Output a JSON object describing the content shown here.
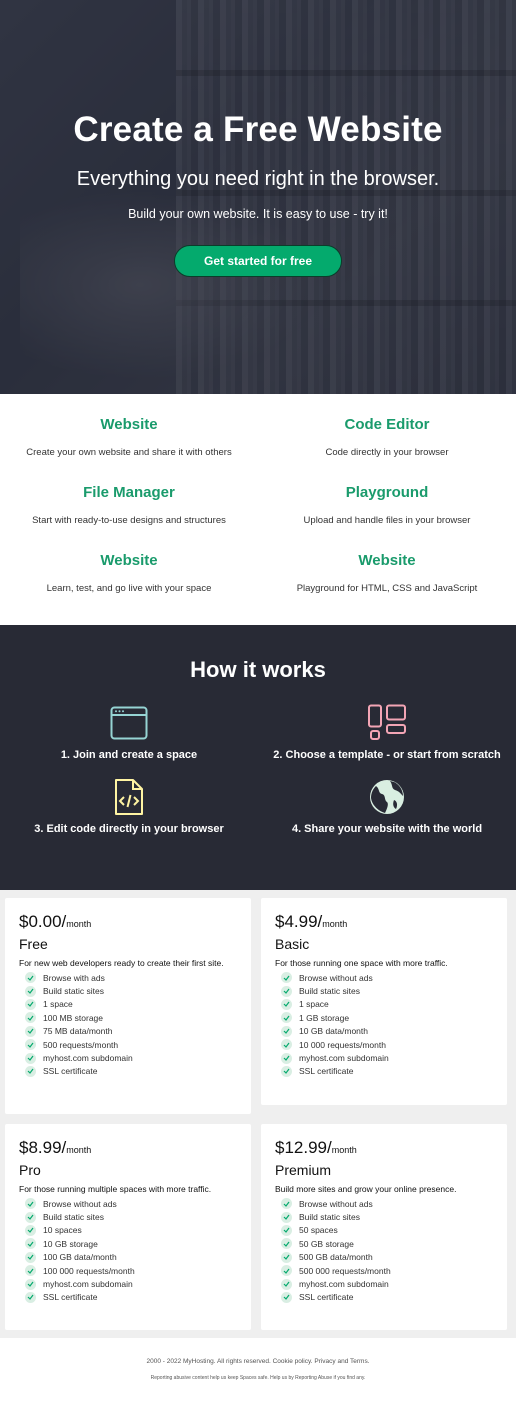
{
  "hero": {
    "title": "Create a Free Website",
    "subtitle": "Everything you need right in the browser.",
    "tagline": "Build your own website. It is easy to use - try it!",
    "cta": "Get started for free"
  },
  "features": [
    {
      "title": "Website",
      "text": "Create your own website and share it with others"
    },
    {
      "title": "Code Editor",
      "text": "Code directly in your browser"
    },
    {
      "title": "File Manager",
      "text": "Start with ready-to-use designs and structures"
    },
    {
      "title": "Playground",
      "text": "Upload and handle files in your browser"
    },
    {
      "title": "Website",
      "text": "Learn, test, and go live with your space"
    },
    {
      "title": "Website",
      "text": "Playground for HTML, CSS and JavaScript"
    }
  ],
  "how": {
    "title": "How it works",
    "steps": [
      {
        "label": "1. Join and create a space",
        "icon": "browser-window-icon"
      },
      {
        "label": "2. Choose a template - or start from scratch",
        "icon": "layout-template-icon"
      },
      {
        "label": "3. Edit code directly in your browser",
        "icon": "code-file-icon"
      },
      {
        "label": "4. Share your website with the world",
        "icon": "globe-icon"
      }
    ]
  },
  "plans": [
    {
      "price": "$0.00/",
      "per": "month",
      "name": "Free",
      "desc": "For new web developers ready to create their first site.",
      "features": [
        "Browse with ads",
        "Build static sites",
        "1 space",
        "100 MB storage",
        "75 MB data/month",
        "500 requests/month",
        "myhost.com subdomain",
        "SSL certificate"
      ]
    },
    {
      "price": "$4.99/",
      "per": "month",
      "name": "Basic",
      "desc": "For those running one space with more traffic.",
      "features": [
        "Browse without ads",
        "Build static sites",
        "1 space",
        "1 GB storage",
        "10 GB data/month",
        "10 000 requests/month",
        "myhost.com subdomain",
        "SSL certificate"
      ]
    },
    {
      "price": "$8.99/",
      "per": "month",
      "name": "Pro",
      "desc": "For those running multiple spaces with more traffic.",
      "features": [
        "Browse without ads",
        "Build static sites",
        "10 spaces",
        "10 GB storage",
        "100 GB data/month",
        "100 000 requests/month",
        "myhost.com subdomain",
        "SSL certificate"
      ]
    },
    {
      "price": "$12.99/",
      "per": "month",
      "name": "Premium",
      "desc": "Build more sites and grow your online presence.",
      "features": [
        "Browse without ads",
        "Build static sites",
        "50 spaces",
        "50 GB storage",
        "500 GB data/month",
        "500 000 requests/month",
        "myhost.com subdomain",
        "SSL certificate"
      ]
    }
  ],
  "footer": {
    "line1": "2000 - 2022 MyHosting. All rights reserved. Cookie policy. Privacy and Terms.",
    "line2": "Reporting abusive content help us keep Spaces safe. Help us by Reporting Abuse if you find any."
  },
  "colors": {
    "accent": "#04aa6d",
    "dark": "#282a35",
    "feature_title": "#1a9b6c"
  }
}
